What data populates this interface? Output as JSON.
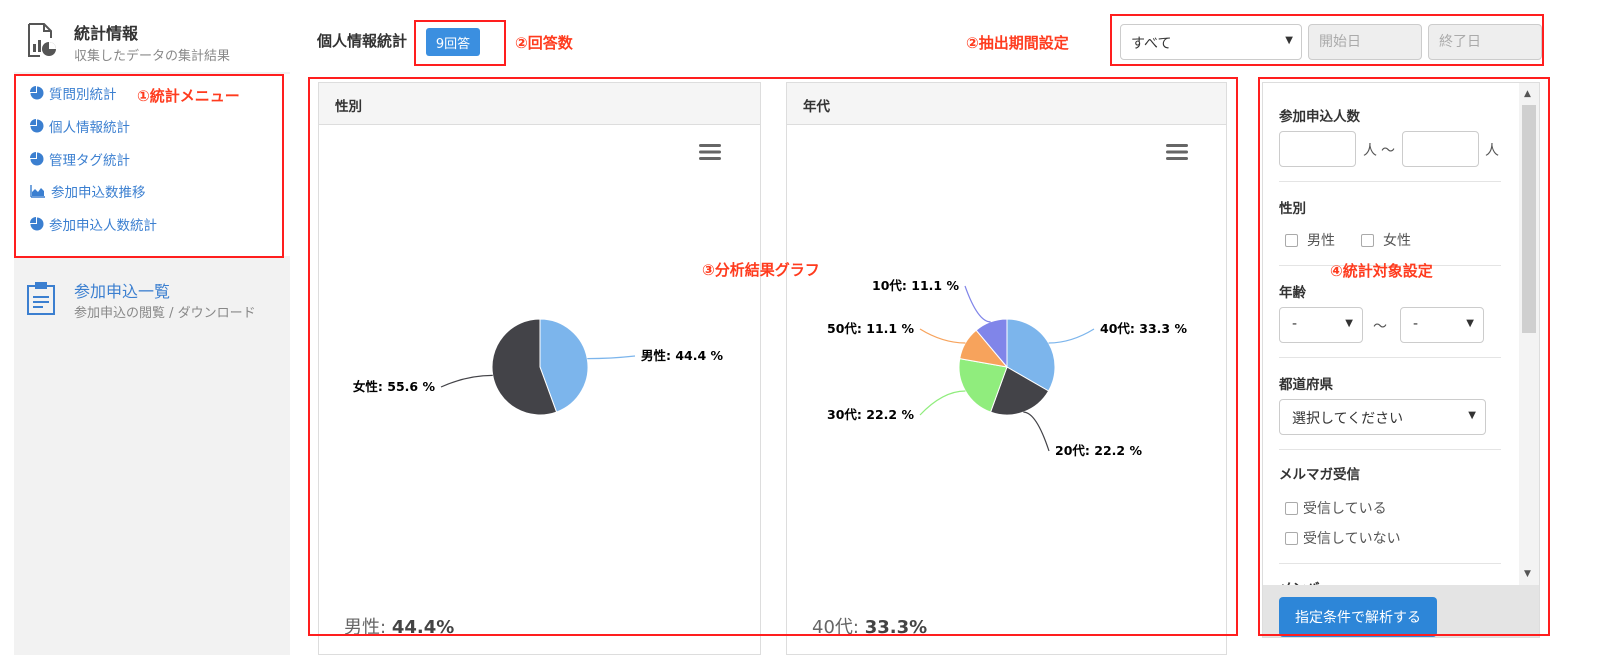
{
  "sidebar": {
    "header": {
      "title": "統計情報",
      "subtitle": "収集したデータの集計結果"
    },
    "menu": [
      {
        "label": "質問別統計",
        "icon": "pie-chart-icon"
      },
      {
        "label": "個人情報統計",
        "icon": "pie-chart-icon"
      },
      {
        "label": "管理タグ統計",
        "icon": "pie-chart-icon"
      },
      {
        "label": "参加申込数推移",
        "icon": "area-chart-icon"
      },
      {
        "label": "参加申込人数統計",
        "icon": "pie-chart-icon"
      }
    ],
    "section2": {
      "title": "参加申込一覧",
      "subtitle": "参加申込の閲覧 / ダウンロード"
    }
  },
  "header": {
    "title": "個人情報統計",
    "answer_count": "9回答",
    "period_select": "すべて",
    "start_placeholder": "開始日",
    "end_placeholder": "終了日"
  },
  "annotations": {
    "menu": "①統計メニュー",
    "count": "②回答数",
    "period": "②抽出期間設定",
    "graph": "③分析結果グラフ",
    "filter": "④統計対象設定"
  },
  "chart_data": [
    {
      "type": "pie",
      "title": "性別",
      "categories": [
        "男性",
        "女性"
      ],
      "values": [
        44.4,
        55.6
      ],
      "labels": [
        "男性: 44.4 %",
        "女性: 55.6 %"
      ],
      "colors": [
        "#7cb5ec",
        "#434348"
      ],
      "summary_label": "男性:",
      "summary_value": "44.4%"
    },
    {
      "type": "pie",
      "title": "年代",
      "categories": [
        "40代",
        "20代",
        "30代",
        "50代",
        "10代"
      ],
      "values": [
        33.3,
        22.2,
        22.2,
        11.1,
        11.1
      ],
      "labels": [
        "40代: 33.3 %",
        "20代: 22.2 %",
        "30代: 22.2 %",
        "50代: 11.1 %",
        "10代: 11.1 %"
      ],
      "colors": [
        "#7cb5ec",
        "#434348",
        "#90ed7d",
        "#f7a35c",
        "#8085e9"
      ],
      "summary_label": "40代:",
      "summary_value": "33.3%"
    }
  ],
  "filter": {
    "participants": {
      "label": "参加申込人数",
      "unit": "人",
      "tilde": "～"
    },
    "gender": {
      "label": "性別",
      "options": [
        "男性",
        "女性"
      ]
    },
    "age": {
      "label": "年齢",
      "from": "-",
      "to": "-",
      "tilde": "～"
    },
    "prefecture": {
      "label": "都道府県",
      "value": "選択してください"
    },
    "mailmag": {
      "label": "メルマガ受信",
      "options": [
        "受信している",
        "受信していない"
      ]
    },
    "cut_label": "メンバ",
    "submit": "指定条件で解析する"
  }
}
